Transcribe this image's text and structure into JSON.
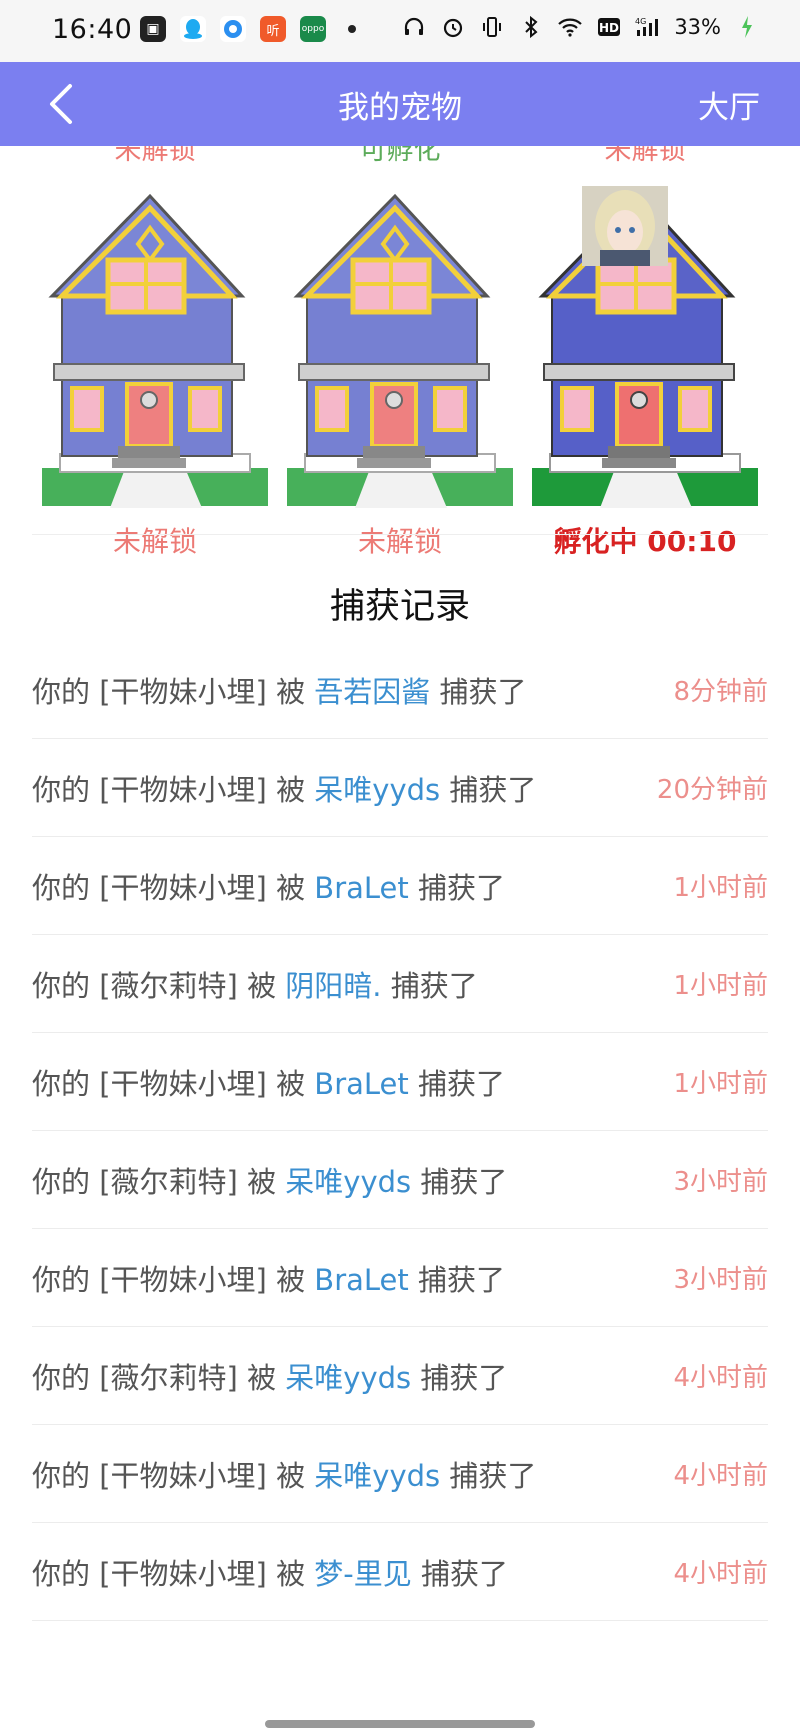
{
  "status_bar": {
    "time": "16:40",
    "battery": "33%",
    "icons": [
      "bilibili-icon",
      "qq-icon",
      "browser-icon",
      "ting-icon",
      "oppo-icon",
      "headphones-icon",
      "alarm-icon",
      "vibrate-icon",
      "bluetooth-icon",
      "wifi-icon",
      "hd-icon",
      "4g-signal-icon",
      "battery-icon"
    ]
  },
  "header": {
    "title": "我的宠物",
    "right_label": "大厅",
    "bg_color": "#7b7ff0"
  },
  "pets": [
    {
      "top_label": "未解锁",
      "top_color": "#ec7a75",
      "label": "未解锁",
      "state": "locked"
    },
    {
      "top_label": "可孵化",
      "top_color": "#5cab5a",
      "label": "未解锁",
      "state": "locked"
    },
    {
      "top_label": "未解锁",
      "top_color": "#ec7a75",
      "label": "孵化中 00:10",
      "state": "hatching"
    }
  ],
  "records_title": "捕获记录",
  "records": [
    {
      "prefix": "你的 [干物妹小埋] 被 ",
      "user": "吾若因酱",
      "suffix": " 捕获了",
      "time": "8分钟前"
    },
    {
      "prefix": "你的 [干物妹小埋] 被 ",
      "user": "呆唯yyds",
      "suffix": " 捕获了",
      "time": "20分钟前"
    },
    {
      "prefix": "你的 [干物妹小埋] 被 ",
      "user": "BraLet",
      "suffix": " 捕获了",
      "time": "1小时前"
    },
    {
      "prefix": "你的 [薇尔莉特] 被 ",
      "user": "阴阳暗.",
      "suffix": " 捕获了",
      "time": "1小时前"
    },
    {
      "prefix": "你的 [干物妹小埋] 被 ",
      "user": "BraLet",
      "suffix": " 捕获了",
      "time": "1小时前"
    },
    {
      "prefix": "你的 [薇尔莉特] 被 ",
      "user": "呆唯yyds",
      "suffix": " 捕获了",
      "time": "3小时前"
    },
    {
      "prefix": "你的 [干物妹小埋] 被 ",
      "user": "BraLet",
      "suffix": " 捕获了",
      "time": "3小时前"
    },
    {
      "prefix": "你的 [薇尔莉特] 被 ",
      "user": "呆唯yyds",
      "suffix": " 捕获了",
      "time": "4小时前"
    },
    {
      "prefix": "你的 [干物妹小埋] 被 ",
      "user": "呆唯yyds",
      "suffix": " 捕获了",
      "time": "4小时前"
    },
    {
      "prefix": "你的 [干物妹小埋] 被 ",
      "user": "梦-里见",
      "suffix": " 捕获了",
      "time": "4小时前"
    }
  ]
}
